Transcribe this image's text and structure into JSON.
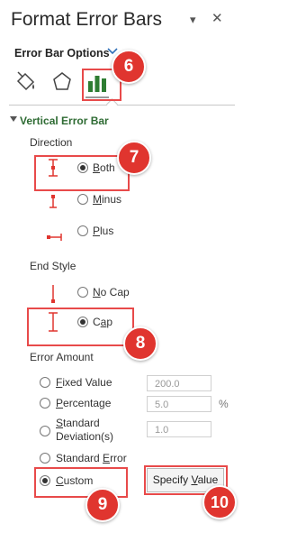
{
  "panel": {
    "title": "Format Error Bars",
    "tab_label": "Error Bar Options"
  },
  "section": {
    "title": "Vertical Error Bar"
  },
  "direction": {
    "heading": "Direction",
    "options": [
      {
        "label": "Both",
        "ul": "B",
        "rest": "oth",
        "selected": true
      },
      {
        "label": "Minus",
        "ul": "M",
        "rest": "inus",
        "selected": false
      },
      {
        "label": "Plus",
        "ul": "P",
        "rest": "lus",
        "selected": false
      }
    ]
  },
  "end_style": {
    "heading": "End Style",
    "options": [
      {
        "label": "No Cap",
        "ul": "N",
        "rest": "o Cap",
        "selected": false
      },
      {
        "label": "Cap",
        "pre": "C",
        "ul": "a",
        "post": "p",
        "selected": true
      }
    ]
  },
  "error_amount": {
    "heading": "Error Amount",
    "fixed": {
      "ul": "F",
      "rest": "ixed Value",
      "value": "200.0"
    },
    "percentage": {
      "ul": "P",
      "rest": "ercentage",
      "value": "5.0",
      "unit": "%"
    },
    "stddev": {
      "ul": "S",
      "rest": "tandard",
      "line2": "Deviation(s)",
      "value": "1.0"
    },
    "stderr": {
      "pre": "Standard ",
      "ul": "E",
      "rest": "rror"
    },
    "custom": {
      "ul": "C",
      "rest": "ustom"
    },
    "specify": {
      "pre": "Specify ",
      "ul": "V",
      "rest": "alue"
    }
  },
  "badges": [
    "6",
    "7",
    "8",
    "9",
    "10"
  ],
  "colors": {
    "accent_green": "#2e6b33",
    "callout_red": "#e84a4a",
    "badge_red": "#e0352f"
  }
}
